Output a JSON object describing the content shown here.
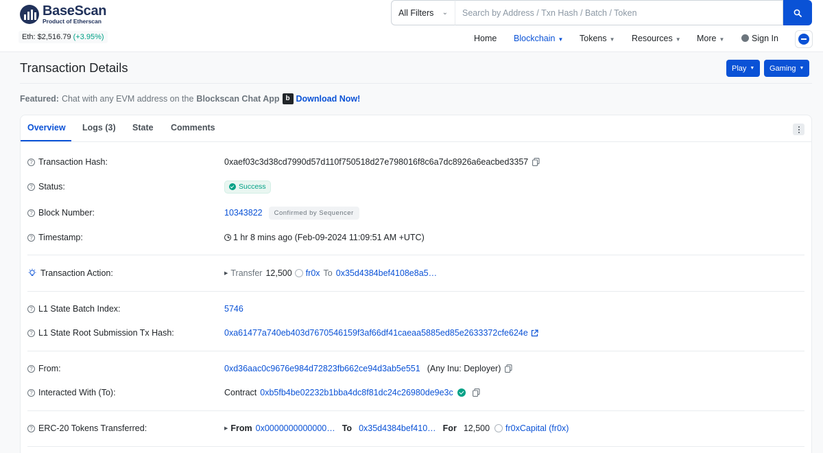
{
  "brand": {
    "name": "BaseScan",
    "subtitle": "Product of Etherscan"
  },
  "eth_price": {
    "label": "Eth:",
    "value": "$2,516.79",
    "change": "(+3.95%)"
  },
  "search": {
    "filter": "All Filters",
    "placeholder": "Search by Address / Txn Hash / Batch / Token"
  },
  "nav": {
    "home": "Home",
    "blockchain": "Blockchain",
    "tokens": "Tokens",
    "resources": "Resources",
    "more": "More",
    "signin": "Sign In"
  },
  "page": {
    "title": "Transaction Details",
    "play_button": "Play",
    "gaming_button": "Gaming"
  },
  "featured": {
    "label": "Featured:",
    "text": "Chat with any EVM address on the",
    "app_name": "Blockscan Chat App",
    "badge": "b",
    "link": "Download Now!"
  },
  "tabs": {
    "overview": "Overview",
    "logs": "Logs (3)",
    "state": "State",
    "comments": "Comments"
  },
  "details": {
    "tx_hash_label": "Transaction Hash:",
    "tx_hash": "0xaef03c3d38cd7990d57d110f750518d27e798016f8c6a7dc8926a6eacbed3357",
    "status_label": "Status:",
    "status": "Success",
    "block_label": "Block Number:",
    "block": "10343822",
    "block_badge": "Confirmed by Sequencer",
    "timestamp_label": "Timestamp:",
    "timestamp": "1 hr 8 mins ago (Feb-09-2024 11:09:51 AM +UTC)",
    "action_label": "Transaction Action:",
    "action_verb": "Transfer",
    "action_amount": "12,500",
    "action_token": "fr0x",
    "action_to": "To",
    "action_address": "0x35d4384bef4108e8a5…",
    "batch_label": "L1 State Batch Index:",
    "batch": "5746",
    "root_label": "L1 State Root Submission Tx Hash:",
    "root_hash": "0xa61477a740eb403d7670546159f3af66df41caeaa5885ed85e2633372cfe624e",
    "from_label": "From:",
    "from_address": "0xd36aac0c9676e984d72823fb662ce94d3ab5e551",
    "from_name": "(Any Inu: Deployer)",
    "to_label": "Interacted With (To):",
    "to_prefix": "Contract",
    "to_address": "0xb5fb4be02232b1bba4dc8f81dc24c26980de9e3c",
    "erc20_label": "ERC-20 Tokens Transferred:",
    "erc20_from_label": "From",
    "erc20_from": "0x0000000000000…",
    "erc20_to_label": "To",
    "erc20_to": "0x35d4384bef410…",
    "erc20_for_label": "For",
    "erc20_amount": "12,500",
    "erc20_token": "fr0xCapital (fr0x)"
  }
}
